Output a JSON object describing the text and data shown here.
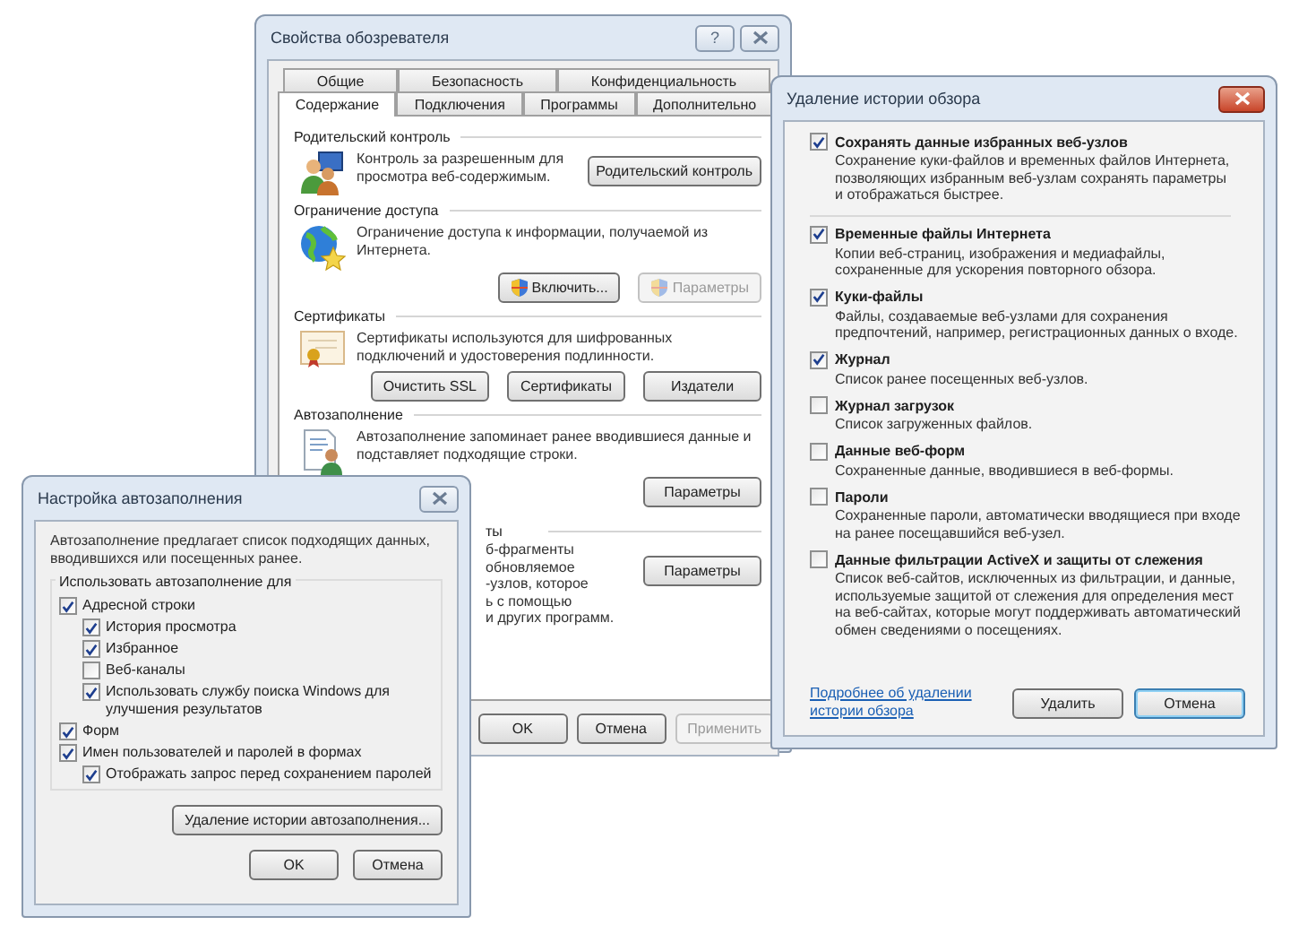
{
  "internet_options": {
    "title": "Свойства обозревателя",
    "help_button": "?",
    "tabs_back": [
      {
        "label": "Общие",
        "selected": false
      },
      {
        "label": "Безопасность",
        "selected": false
      },
      {
        "label": "Конфиденциальность",
        "selected": false
      }
    ],
    "tabs_front": [
      {
        "label": "Содержание",
        "selected": true
      },
      {
        "label": "Подключения",
        "selected": false
      },
      {
        "label": "Программы",
        "selected": false
      },
      {
        "label": "Дополнительно",
        "selected": false
      }
    ],
    "sections": [
      {
        "kind": "parental",
        "title": "Родительский контроль",
        "text": "Контроль за разрешенным для просмотра веб-содержимым.",
        "buttons": [
          {
            "label": "Родительский контроль",
            "disabled": false,
            "shield": false
          }
        ]
      },
      {
        "kind": "access",
        "title": "Ограничение доступа",
        "text": "Ограничение доступа к информации, получаемой из Интернета.",
        "buttons": [
          {
            "label": "Включить...",
            "disabled": false,
            "shield": true
          },
          {
            "label": "Параметры",
            "disabled": true,
            "shield": true
          }
        ]
      },
      {
        "kind": "certificates",
        "title": "Сертификаты",
        "text": "Сертификаты используются для шифрованных подключений и удостоверения подлинности.",
        "buttons": [
          {
            "label": "Очистить SSL",
            "disabled": false,
            "shield": false
          },
          {
            "label": "Сертификаты",
            "disabled": false,
            "shield": false
          },
          {
            "label": "Издатели",
            "disabled": false,
            "shield": false
          }
        ]
      },
      {
        "kind": "autocomplete",
        "title": "Автозаполнение",
        "text": "Автозаполнение запоминает ранее вводившиеся данные и подставляет подходящие строки.",
        "buttons": [
          {
            "label": "Параметры",
            "disabled": false,
            "shield": false
          }
        ]
      }
    ],
    "feeds": {
      "title_fragment": "ты",
      "lines": [
        "б-фрагменты",
        "обновляемое",
        "-узлов, которое",
        "ь с помощью",
        "и других программ."
      ],
      "button": "Параметры"
    },
    "buttons": [
      {
        "label": "OK",
        "disabled": false
      },
      {
        "label": "Отмена",
        "disabled": false
      },
      {
        "label": "Применить",
        "disabled": true
      }
    ]
  },
  "delete_history": {
    "title": "Удаление истории обзора",
    "items": [
      {
        "label": "Сохранять данные избранных веб-узлов",
        "description": "Сохранение куки-файлов и временных файлов Интернета, позволяющих избранным веб-узлам сохранять параметры и отображаться быстрее.",
        "checked": true
      },
      {
        "label": "Временные файлы Интернета",
        "description": "Копии веб-страниц, изображения и медиафайлы, сохраненные для ускорения повторного обзора.",
        "checked": true
      },
      {
        "label": "Куки-файлы",
        "description": "Файлы, создаваемые веб-узлами для сохранения предпочтений, например, регистрационных данных о входе.",
        "checked": true
      },
      {
        "label": "Журнал",
        "description": "Список ранее посещенных веб-узлов.",
        "checked": true
      },
      {
        "label": "Журнал загрузок",
        "description": "Список загруженных файлов.",
        "checked": false
      },
      {
        "label": "Данные веб-форм",
        "description": "Сохраненные данные, вводившиеся в веб-формы.",
        "checked": false
      },
      {
        "label": "Пароли",
        "description": "Сохраненные пароли, автоматически вводящиеся при входе на ранее посещавшийся веб-узел.",
        "checked": false
      },
      {
        "label": "Данные фильтрации ActiveX и защиты от слежения",
        "description": "Список веб-сайтов, исключенных из фильтрации, и данные, используемые защитой от слежения для определения мест на веб-сайтах, которые могут поддерживать автоматический обмен сведениями о посещениях.",
        "checked": false
      }
    ],
    "link": "Подробнее об удалении истории обзора",
    "buttons": [
      {
        "label": "Удалить",
        "default": false
      },
      {
        "label": "Отмена",
        "default": true
      }
    ]
  },
  "autocomplete_settings": {
    "title": "Настройка автозаполнения",
    "intro": "Автозаполнение предлагает список подходящих данных, вводившихся или посещенных ранее.",
    "group_title": "Использовать автозаполнение для",
    "options": [
      {
        "label": "Адресной строки",
        "checked": true,
        "children": [
          {
            "label": "История просмотра",
            "checked": true
          },
          {
            "label": "Избранное",
            "checked": true
          },
          {
            "label": "Веб-каналы",
            "checked": false
          },
          {
            "label": "Использовать службу поиска Windows для улучшения результатов",
            "checked": true
          }
        ]
      },
      {
        "label": "Форм",
        "checked": true
      },
      {
        "label": "Имен пользователей и паролей в формах",
        "checked": true,
        "children": [
          {
            "label": "Отображать запрос перед сохранением паролей",
            "checked": true
          }
        ]
      }
    ],
    "delete_button": "Удаление истории автозаполнения...",
    "buttons": [
      {
        "label": "OK"
      },
      {
        "label": "Отмена"
      }
    ]
  }
}
